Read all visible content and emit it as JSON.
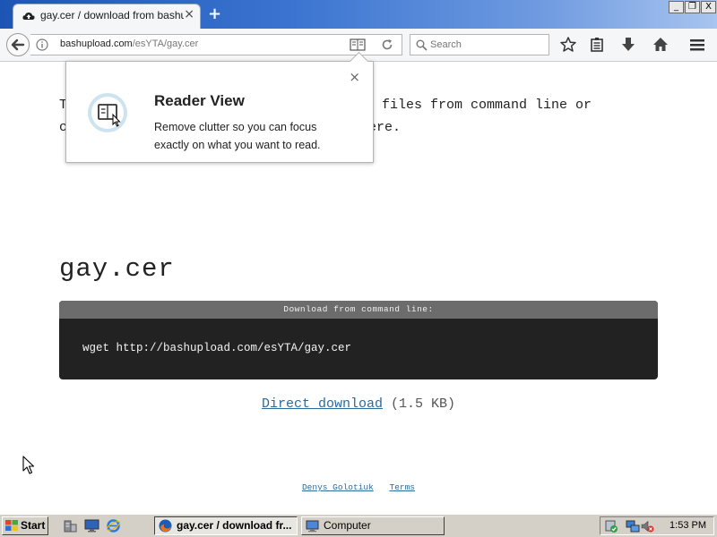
{
  "browser": {
    "tab_title": "gay.cer / download from bashupload",
    "tab_close": "×",
    "new_tab": "+",
    "window_controls": {
      "minimize": "_",
      "restore": "❐",
      "close": "X"
    },
    "url_host": "bashupload.com",
    "url_path": "/esYTA/gay.cer",
    "search_placeholder": "Search",
    "icons": [
      "back-icon",
      "info-icon",
      "reader-view-icon",
      "reload-icon",
      "search-icon",
      "bookmark-star-icon",
      "reading-list-icon",
      "downloads-icon",
      "home-icon",
      "menu-icon"
    ]
  },
  "reader_popup": {
    "title": "Reader View",
    "description": "Remove clutter so you can focus exactly on what you want to read.",
    "close": "×"
  },
  "page": {
    "intro_line1_start": "T",
    "intro_line1_end": "files from command line or",
    "intro_line2_start": "c",
    "intro_line2_end": "ere.",
    "file_name": "gay.cer",
    "cmd_header": "Download from command line:",
    "cmd_text": "wget http://bashupload.com/esYTA/gay.cer",
    "direct_download_link": "Direct download",
    "file_size": "(1.5 KB)",
    "footer_author": "Denys Golotiuk",
    "footer_terms": "Terms"
  },
  "taskbar": {
    "start_label": "Start",
    "tasks": [
      {
        "label": "gay.cer / download fr...",
        "active": true
      },
      {
        "label": "Computer",
        "active": false
      }
    ],
    "clock": "1:53 PM"
  },
  "colors": {
    "titlebar": "#1d55b5",
    "link": "#2a6b9e",
    "cmd_bg": "#222222",
    "cmd_header_bg": "#6c6c6c",
    "taskbar": "#d4d0c8"
  }
}
